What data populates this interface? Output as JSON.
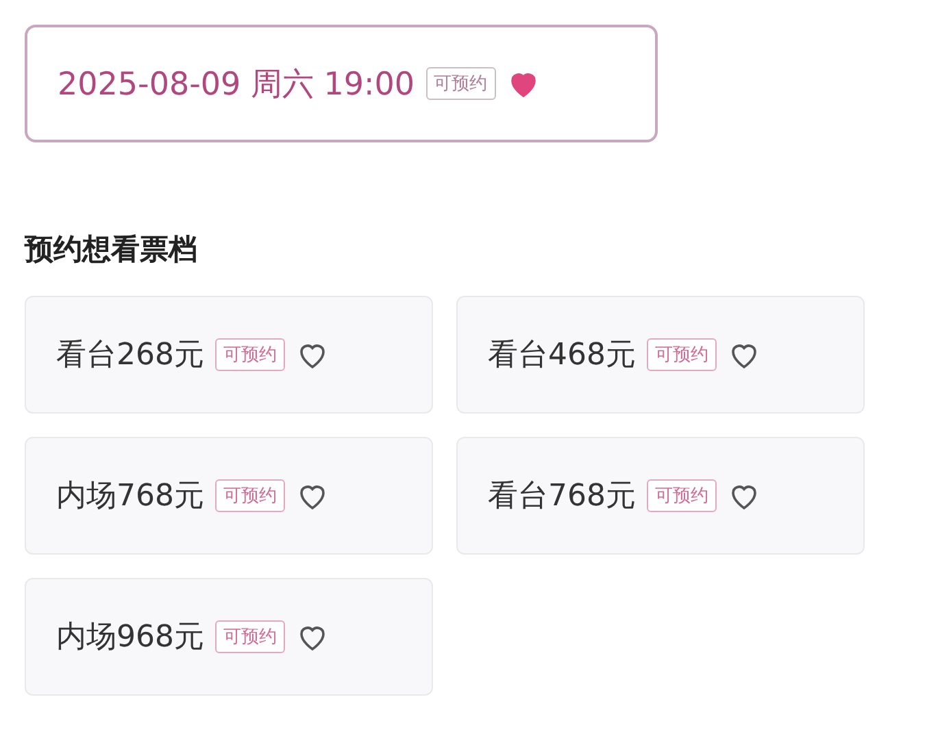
{
  "session": {
    "date": "2025-08-09",
    "weekday": "周六",
    "time": "19:00",
    "badge": "可预约",
    "selected": true,
    "favorited": true
  },
  "section_title": "预约想看票档",
  "tiers": [
    {
      "label": "看台268元",
      "badge": "可预约",
      "favorited": false
    },
    {
      "label": "看台468元",
      "badge": "可预约",
      "favorited": false
    },
    {
      "label": "内场768元",
      "badge": "可预约",
      "favorited": false
    },
    {
      "label": "看台768元",
      "badge": "可预约",
      "favorited": false
    },
    {
      "label": "内场968元",
      "badge": "可预约",
      "favorited": false
    }
  ]
}
